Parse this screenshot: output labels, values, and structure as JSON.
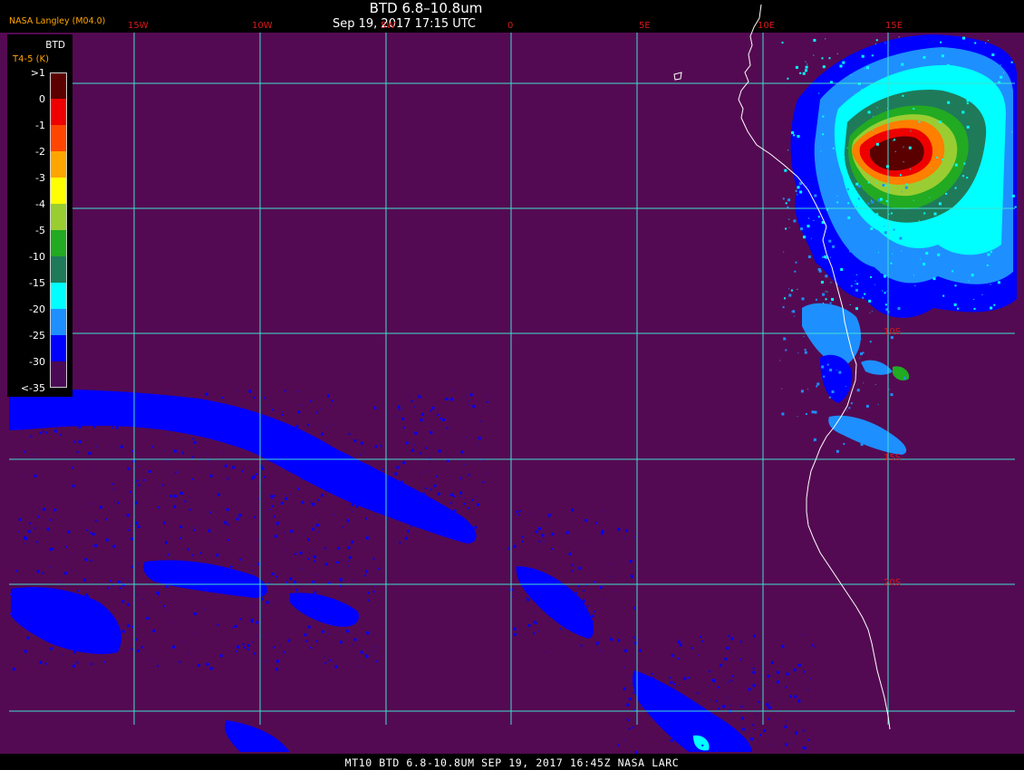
{
  "header": {
    "title": "BTD 6.8–10.8um",
    "datetime": "Sep 19, 2017 17:15 UTC",
    "agency": "NASA Langley (M04.0)"
  },
  "legend": {
    "title": "BTD",
    "unit_label": "T4-5 (K)",
    "items": [
      {
        "label": ">1",
        "color": "#5a0000"
      },
      {
        "label": "0",
        "color": "#ee0000"
      },
      {
        "label": "-1",
        "color": "#ff4500"
      },
      {
        "label": "-2",
        "color": "#ffa500"
      },
      {
        "label": "-3",
        "color": "#ffff00"
      },
      {
        "label": "-4",
        "color": "#9acd32"
      },
      {
        "label": "-5",
        "color": "#22aa22"
      },
      {
        "label": "-10",
        "color": "#1f7a5a"
      },
      {
        "label": "-15",
        "color": "#00ffff"
      },
      {
        "label": "-20",
        "color": "#1e8fff"
      },
      {
        "label": "-25",
        "color": "#0000ff"
      },
      {
        "label": "-30",
        "color": "#4b0a55"
      },
      {
        "label": "<-35",
        "color": null
      }
    ]
  },
  "map": {
    "background_color": "#540a52",
    "grid_color": "#40e0d0",
    "coast_color": "#ffffff",
    "longitude_labels": [
      "15W",
      "10W",
      "5W",
      "0",
      "5E",
      "10E",
      "15E"
    ],
    "latitude_labels": [
      "10S",
      "15S",
      "20S"
    ]
  },
  "footer": {
    "text": "MT10  BTD 6.8-10.8UM  SEP 19, 2017 16:45Z  NASA LARC"
  }
}
